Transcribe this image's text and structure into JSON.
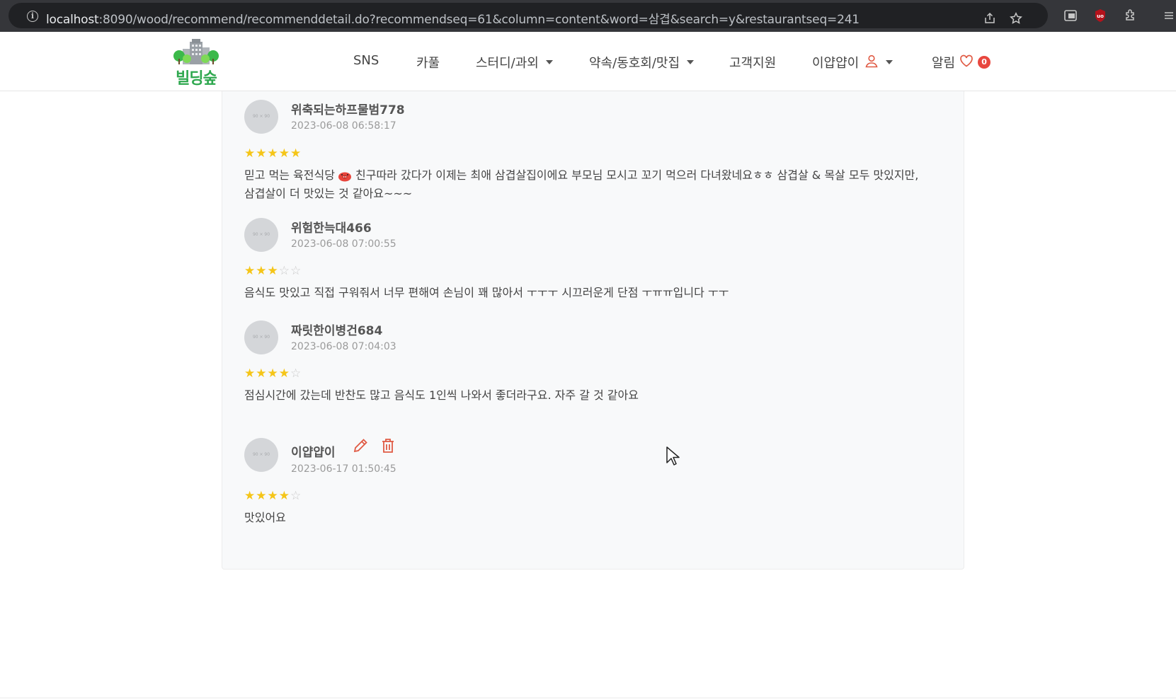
{
  "browser": {
    "url_host": "localhost",
    "url_rest": ":8090/wood/recommend/recommenddetail.do?recommendseq=61&column=content&word=삼겹&search=y&restaurantseq=241"
  },
  "header": {
    "logo_text": "빌딩숲",
    "nav": {
      "sns": "SNS",
      "carpool": "카풀",
      "study": "스터디/과외",
      "meet": "약속/동호회/맛집",
      "support": "고객지원",
      "user": "이얍얍이",
      "alarm": "알림",
      "alarm_count": "0"
    }
  },
  "reviews": [
    {
      "avatar": "90 × 90",
      "nickname": "위축되는하프물범778",
      "date": "2023-06-08 06:58:17",
      "rating": 5,
      "stars_on": "★★★★★",
      "stars_off": "",
      "content_line1_a": "믿고 먹는 육전식당",
      "content_line1_b": " 친구따라 갔다가 이제는 최애 삼겹살집이에요 부모님 모시고 꼬기 먹으러 다녀왔네요ㅎㅎ 삼겹살 & 목살 모두 맛있지만,",
      "content_line2": "삼겹살이 더 맛있는 것 같아요~~~"
    },
    {
      "avatar": "90 × 90",
      "nickname": "위험한늑대466",
      "date": "2023-06-08 07:00:55",
      "rating": 3,
      "stars_on": "★★★",
      "stars_off": "☆☆",
      "content": "음식도 맛있고 직접 구워줘서 너무 편해여 손님이 꽤 많아서 ㅜㅜㅜ 시끄러운게 단점 ㅜㅠㅠ입니다 ㅜㅜ"
    },
    {
      "avatar": "90 × 90",
      "nickname": "짜릿한이병건684",
      "date": "2023-06-08 07:04:03",
      "rating": 4,
      "stars_on": "★★★★",
      "stars_off": "☆",
      "content": "점심시간에 갔는데 반찬도 많고 음식도 1인씩 나와서 좋더라구요. 자주 갈 것 같아요"
    },
    {
      "avatar": "90 × 90",
      "nickname": "이얍얍이",
      "date": "2023-06-17 01:50:45",
      "rating": 4,
      "stars_on": "★★★★",
      "stars_off": "☆",
      "content": "맛있어요"
    }
  ],
  "colors": {
    "accent_green": "#2fa84f",
    "star": "#f5c518",
    "badge": "#e8473f",
    "action_icon": "#e05a44"
  }
}
